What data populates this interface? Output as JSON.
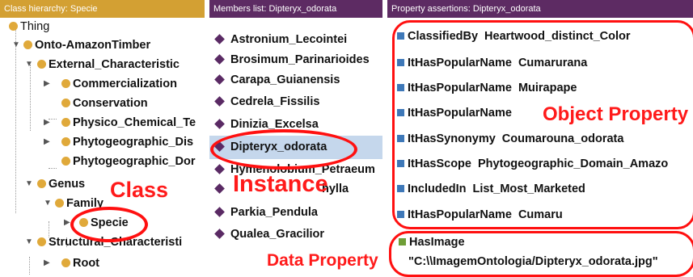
{
  "class_panel": {
    "header": "Class hierarchy: Specie",
    "items": [
      {
        "label": "Thing"
      },
      {
        "label": "Onto-AmazonTimber"
      },
      {
        "label": "External_Characteristic"
      },
      {
        "label": "Commercialization"
      },
      {
        "label": "Conservation"
      },
      {
        "label": "Physico_Chemical_Te"
      },
      {
        "label": "Phytogeographic_Dis"
      },
      {
        "label": "Phytogeographic_Dor"
      },
      {
        "label": "Genus"
      },
      {
        "label": "Family"
      },
      {
        "label": "Specie"
      },
      {
        "label": "Structural_Characteristi"
      },
      {
        "label": "Root"
      }
    ]
  },
  "members_panel": {
    "header": "Members list: Dipteryx_odorata",
    "items": [
      {
        "label": "Astronium_Lecointei"
      },
      {
        "label": "Brosimum_Parinarioides"
      },
      {
        "label": "Carapa_Guianensis"
      },
      {
        "label": "Cedrela_Fissilis"
      },
      {
        "label": "Dinizia_Excelsa"
      },
      {
        "label": "Dipteryx_odorata"
      },
      {
        "label": "Hymenolobium_Petraeum"
      },
      {
        "label": "hylla"
      },
      {
        "label": "Parkia_Pendula"
      },
      {
        "label": "Qualea_Gracilior"
      }
    ],
    "selected": "Dipteryx_odorata"
  },
  "properties_panel": {
    "header": "Property assertions: Dipteryx_odorata",
    "object_properties": [
      {
        "property": "ClassifiedBy",
        "value": "Heartwood_distinct_Color"
      },
      {
        "property": "ItHasPopularName",
        "value": "Cumarurana"
      },
      {
        "property": "ItHasPopularName",
        "value": "Muirapape"
      },
      {
        "property": "ItHasPopularName",
        "value": ""
      },
      {
        "property": "ItHasSynonymy",
        "value": "Coumarouna_odorata"
      },
      {
        "property": "ItHasScope",
        "value": "Phytogeographic_Domain_Amazo"
      },
      {
        "property": "IncludedIn",
        "value": "List_Most_Marketed"
      },
      {
        "property": "ItHasPopularName",
        "value": "Cumaru"
      }
    ],
    "data_property": {
      "property": "HasImage",
      "value": "\"C:\\\\ImagemOntologia/Dipteryx_odorata.jpg\""
    }
  },
  "annotations": {
    "class": "Class",
    "instance": "Instance",
    "object_property": "Object Property",
    "data_property": "Data Property"
  },
  "colors": {
    "class_header": "#d3a033",
    "list_header": "#5d2b63",
    "annotation_red": "#ff1a1a",
    "selection": "#c5d7ec",
    "class_dot": "#e0a93a",
    "instance_diamond": "#5a2a64",
    "object_property_square": "#3e78b8",
    "data_property_square": "#6f9e37"
  }
}
